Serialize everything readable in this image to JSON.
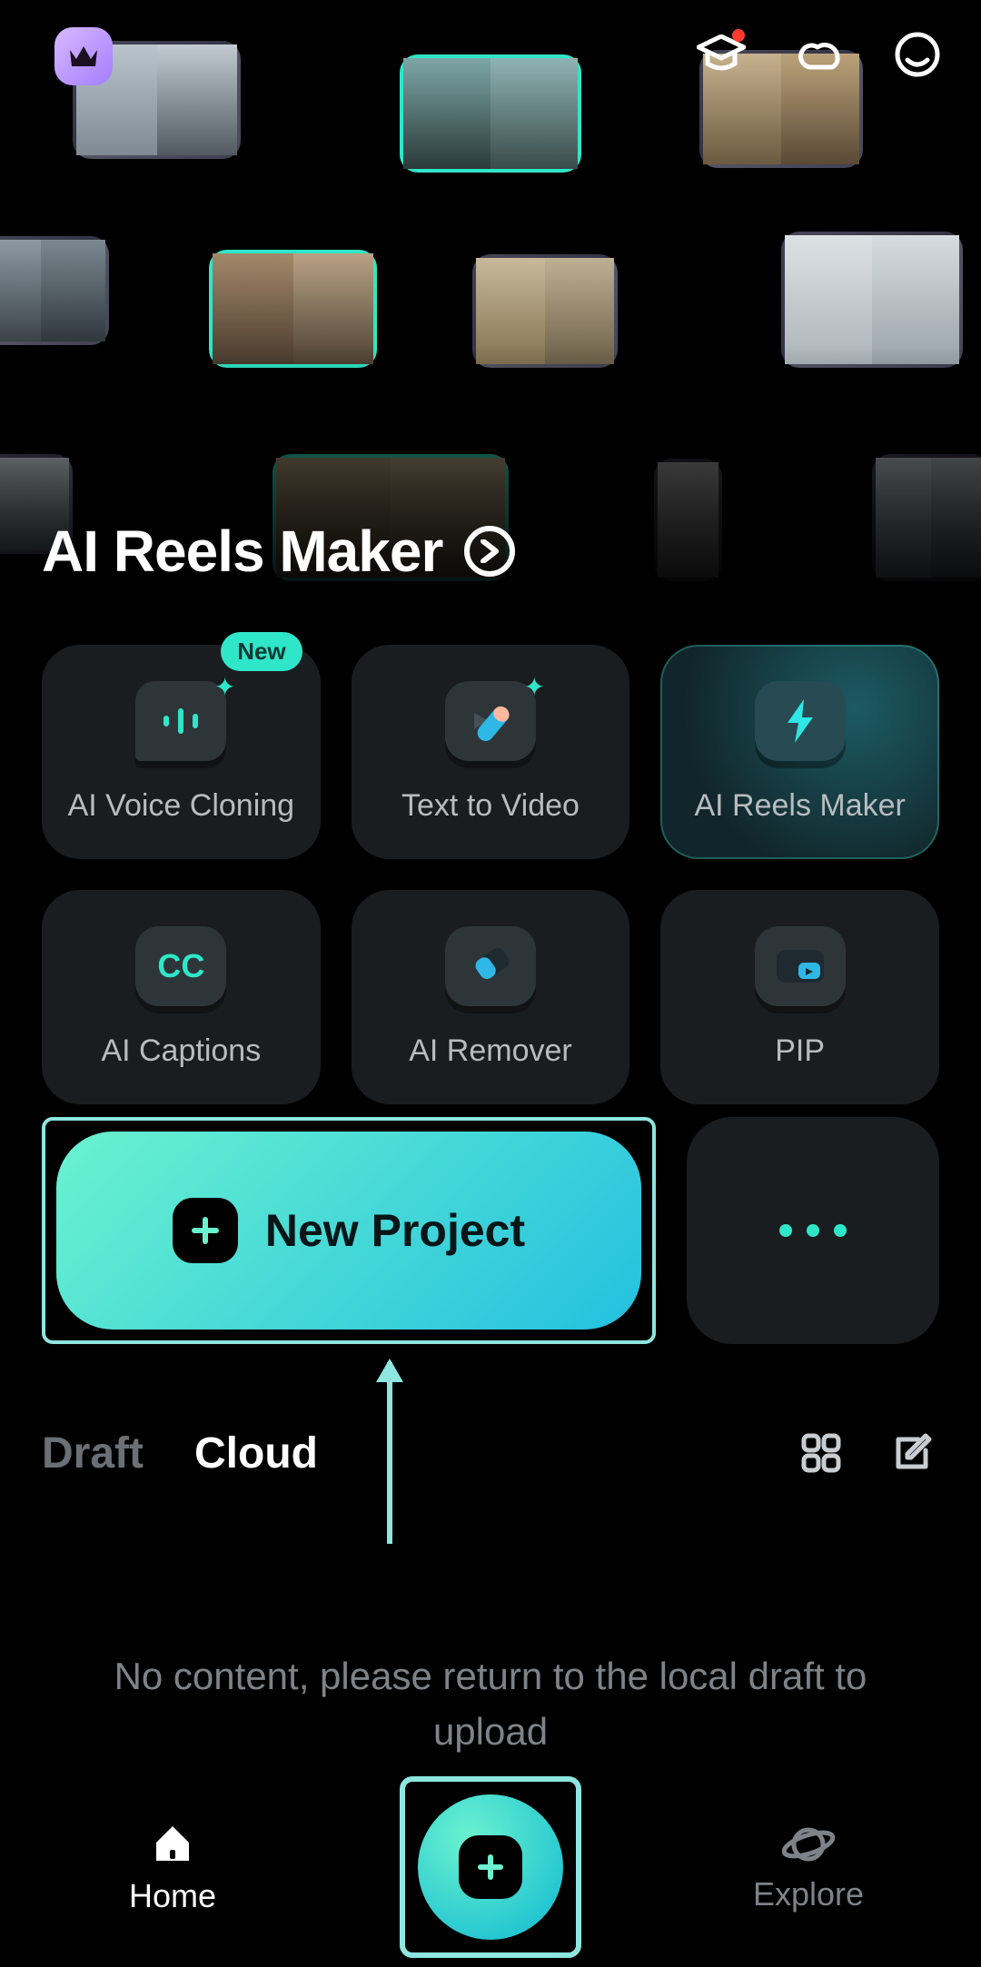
{
  "hero": {
    "title": "AI Reels Maker"
  },
  "features": {
    "voice_cloning": {
      "label": "AI Voice Cloning",
      "badge": "New"
    },
    "text_to_video": {
      "label": "Text to Video"
    },
    "ai_reels": {
      "label": "AI Reels Maker"
    },
    "ai_captions": {
      "label": "AI Captions",
      "icon_text": "CC"
    },
    "ai_remover": {
      "label": "AI Remover"
    },
    "pip": {
      "label": "PIP"
    }
  },
  "new_project": {
    "label": "New Project"
  },
  "tabs": {
    "draft": "Draft",
    "cloud": "Cloud"
  },
  "empty_message": "No content, please return to the local draft to upload",
  "nav": {
    "home": "Home",
    "explore": "Explore"
  }
}
